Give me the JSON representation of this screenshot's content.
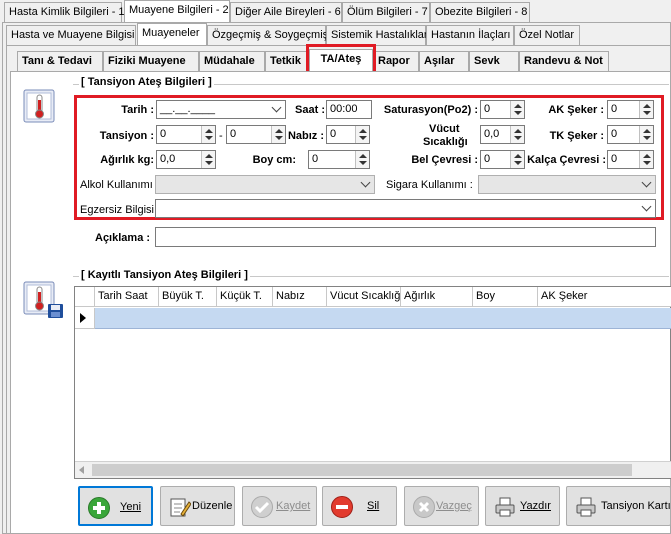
{
  "top_tabs": [
    "Hasta Kimlik Bilgileri - 1",
    "Muayene Bilgileri - 2",
    "Diğer Aile Bireyleri - 6",
    "Ölüm Bilgileri - 7",
    "Obezite Bilgileri - 8"
  ],
  "second_tabs": [
    "Hasta ve Muayene Bilgisi",
    "Muayeneler",
    "Özgeçmiş & Soygeçmiş",
    "Sistemik Hastalıklar",
    "Hastanın İlaçları",
    "Özel Notlar"
  ],
  "third_tabs": [
    "Tanı & Tedavi",
    "Fiziki Muayene",
    "Müdahale",
    "Tetkik",
    "TA/Ateş",
    "Rapor",
    "Aşılar",
    "Sevk",
    "Randevu & Not"
  ],
  "section1": {
    "title": "[ Tansiyon Ateş Bilgileri ]",
    "tarih_label": "Tarih :",
    "tarih_value": "__.__.____",
    "saat_label": "Saat :",
    "saat_value": "00:00",
    "saturasyon_label": "Saturasyon(Po2) :",
    "saturasyon_value": "0",
    "ak_seker_label": "AK Şeker :",
    "ak_seker_value": "0",
    "tansiyon_label": "Tansiyon :",
    "tansiyon_buyuk": "0",
    "tansiyon_sep": "-",
    "tansiyon_kucuk": "0",
    "nabiz_label": "Nabız :",
    "nabiz_value": "0",
    "vucut_label_1": "Vücut",
    "vucut_label_2": "Sıcaklığı",
    "vucut_value": "0,0",
    "tk_seker_label": "TK Şeker :",
    "tk_seker_value": "0",
    "agirlik_label": "Ağırlık kg:",
    "agirlik_value": "0,0",
    "boy_label": "Boy cm:",
    "boy_value": "0",
    "bel_label": "Bel Çevresi :",
    "bel_value": "0",
    "kalca_label": "Kalça Çevresi :",
    "kalca_value": "0",
    "alkol_label": "Alkol Kullanımı :",
    "sigara_label": "Sigara Kullanımı :",
    "egzersiz_label": "Egzersiz Bilgisi :",
    "aciklama_label": "Açıklama :"
  },
  "section2": {
    "title": "[ Kayıtlı Tansiyon Ateş Bilgileri ]",
    "columns": [
      "Tarih Saat",
      "Büyük T.",
      "Küçük T.",
      "Nabız",
      "Vücut Sıcaklığı",
      "Ağırlık",
      "Boy",
      "AK Şeker"
    ]
  },
  "buttons": {
    "yeni": "Yeni",
    "duzenle": "Düzenle",
    "kaydet": "Kaydet",
    "sil": "Sil",
    "vazgec": "Vazgeç",
    "yazdir": "Yazdır",
    "tansiyon_karti": "Tansiyon Kartı"
  },
  "colors": {
    "highlight": "#e01b24",
    "selected_row": "#c5d9f1"
  }
}
